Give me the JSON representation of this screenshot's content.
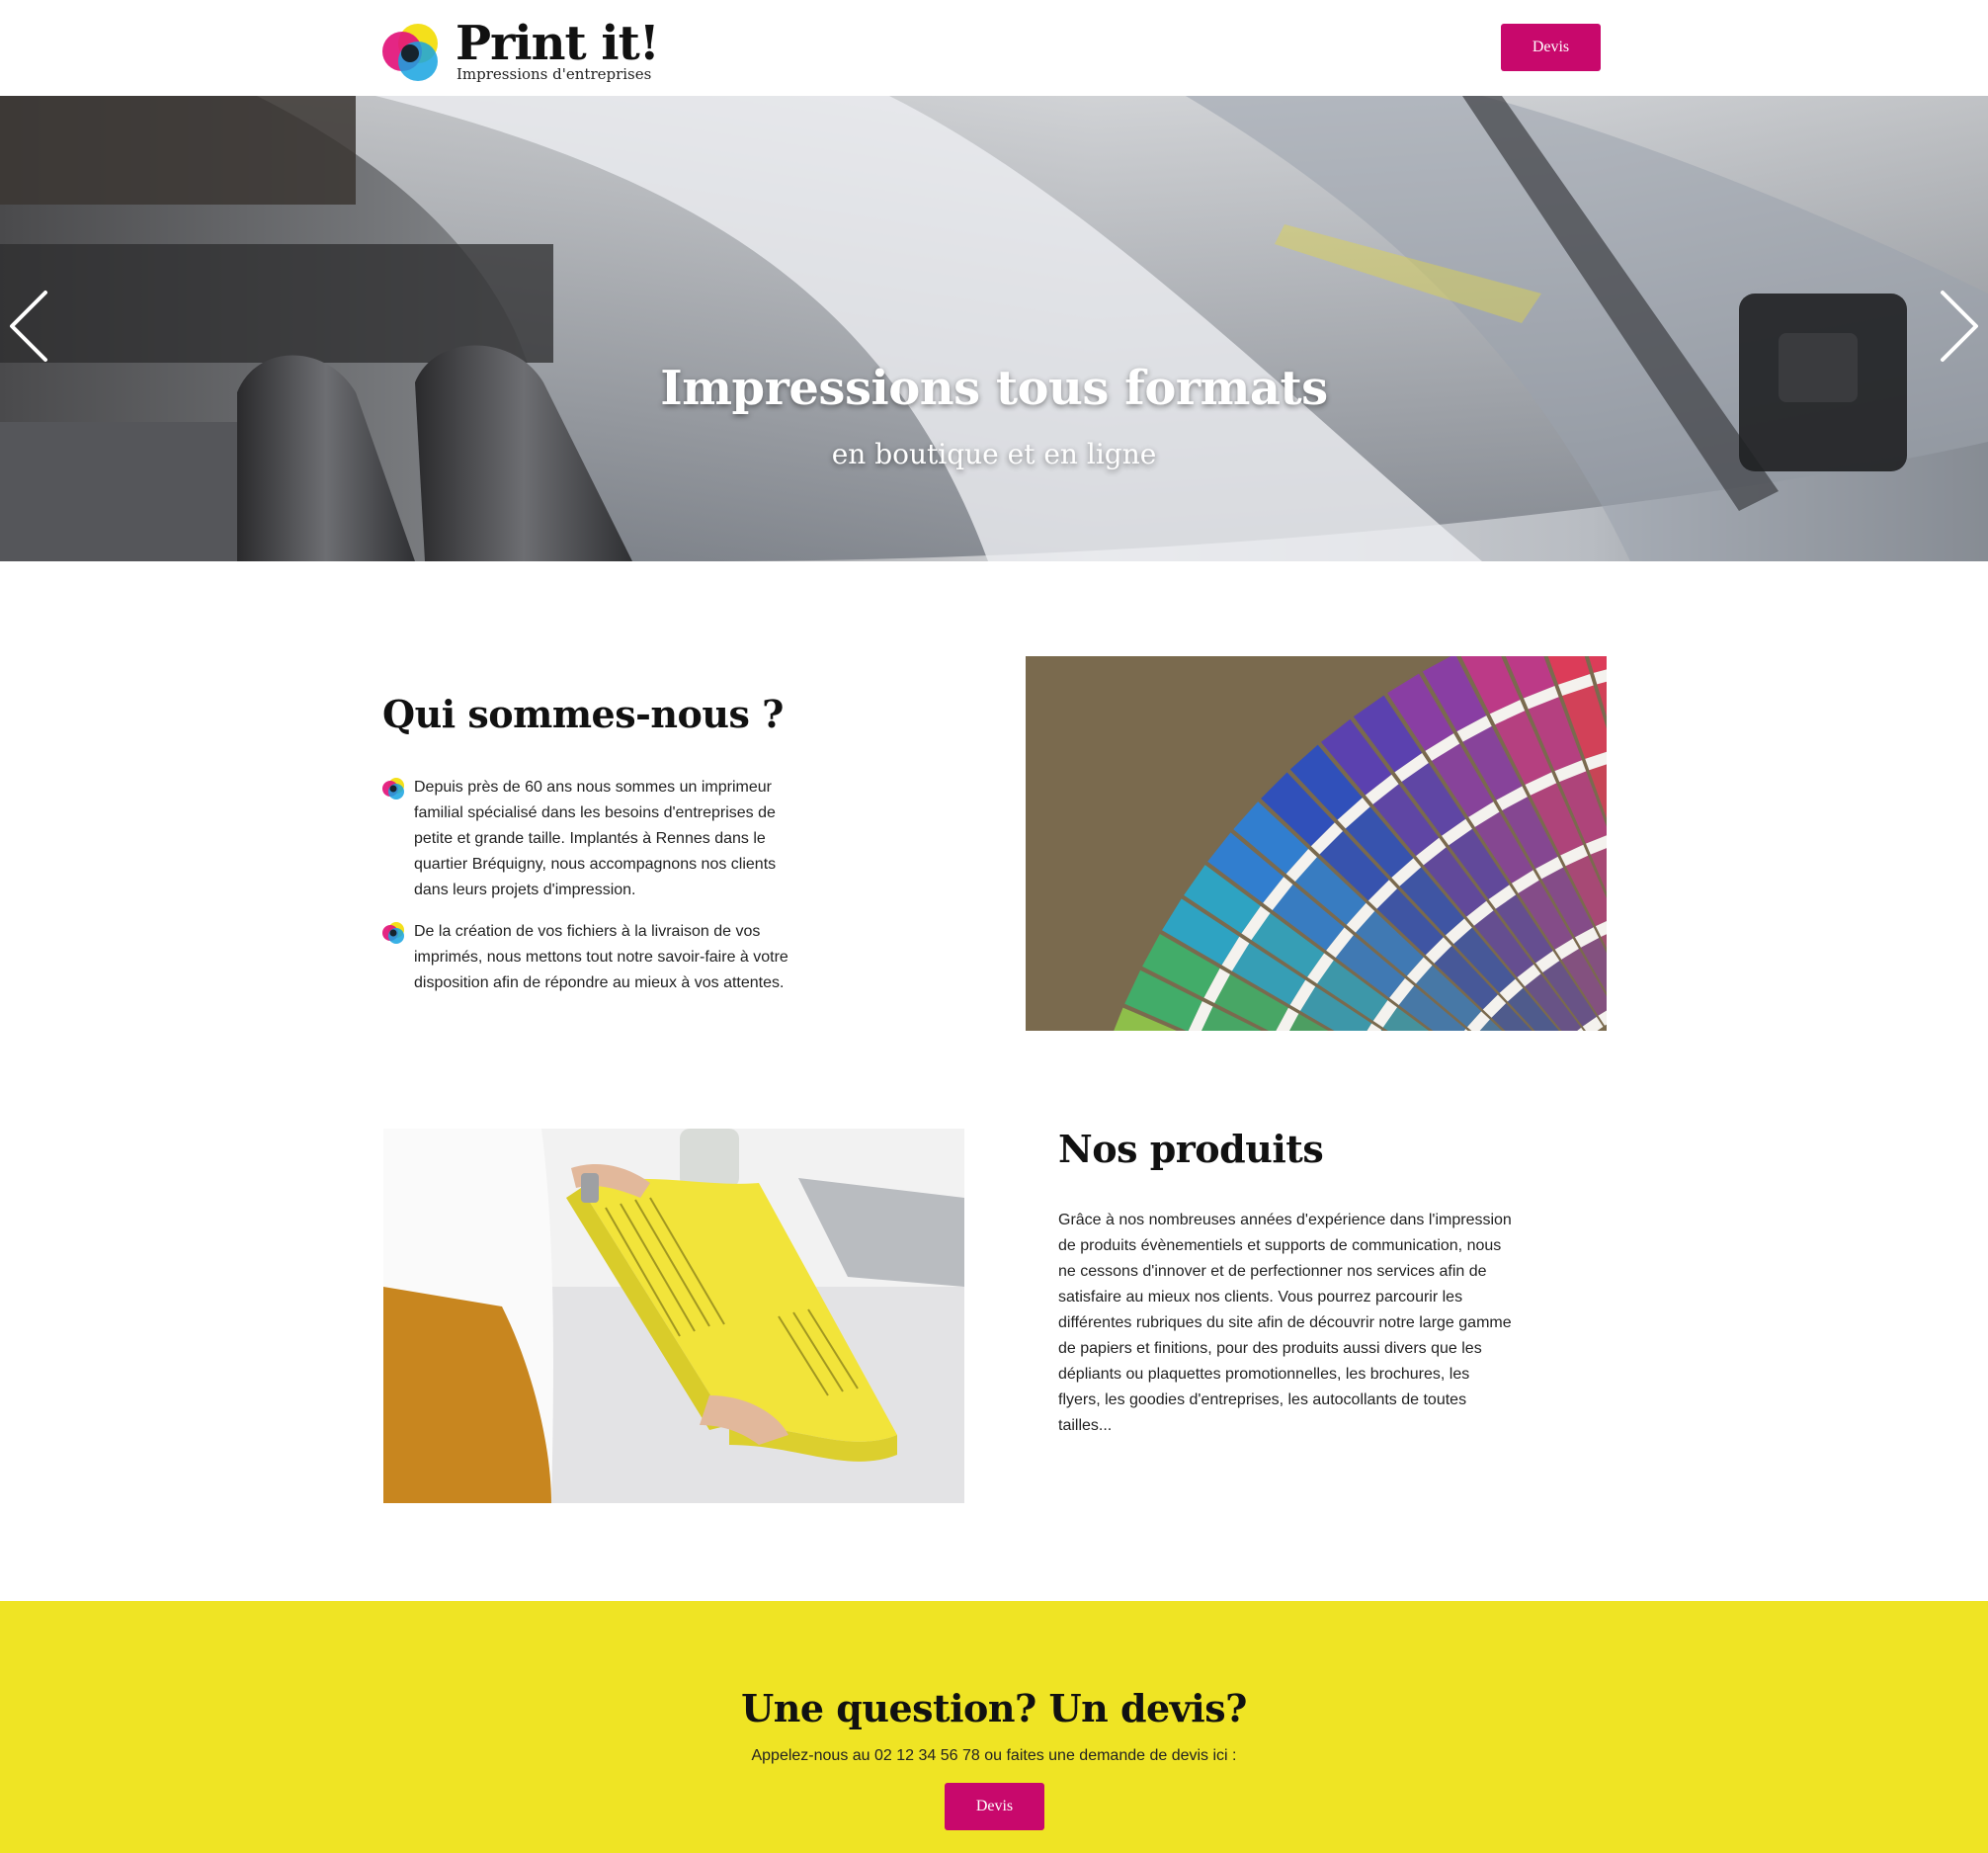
{
  "header": {
    "logo_title": "Print it!",
    "logo_subtitle": "Impressions d'entreprises",
    "quote_button": "Devis"
  },
  "hero": {
    "title": "Impressions tous formats",
    "subtitle": "en boutique et en ligne",
    "slide_count": 4,
    "active_slide": 1
  },
  "about": {
    "title": "Qui sommes-nous ?",
    "bullets": [
      "Depuis près de 60 ans nous sommes un imprimeur familial spécialisé dans les besoins d'entreprises de petite et grande taille. Implantés à Rennes dans le quartier Bréquigny, nous accompagnons nos clients dans leurs projets d'impression.",
      "De la création de vos fichiers à la livraison de vos imprimés, nous mettons tout notre savoir-faire à votre disposition afin de répondre au mieux à vos attentes."
    ]
  },
  "products": {
    "title": "Nos produits",
    "text": "Grâce à nos nombreuses années d'expérience dans l'impression de produits évènementiels et supports de communication, nous ne cessons d'innover et de perfectionner nos services afin de satisfaire au mieux nos clients. Vous pourrez parcourir les différentes rubriques du site afin de découvrir notre large gamme de papiers et finitions, pour des produits aussi divers que les dépliants ou plaquettes promotionnelles, les brochures, les flyers, les goodies d'entreprises, les autocollants de toutes tailles..."
  },
  "cta": {
    "title": "Une question? Un devis?",
    "text": "Appelez-nous au 02 12 34 56 78 ou faites une demande de devis ici :",
    "button": "Devis"
  },
  "colors": {
    "accent": "#c8086c",
    "cta_background": "#efe424",
    "logo_cyan": "#16a3e0",
    "logo_magenta": "#e2137a",
    "logo_yellow": "#f4e01b"
  },
  "icons": {
    "prev": "chevron-left-icon",
    "next": "chevron-right-icon",
    "bullet": "cmyk-circles-icon"
  }
}
